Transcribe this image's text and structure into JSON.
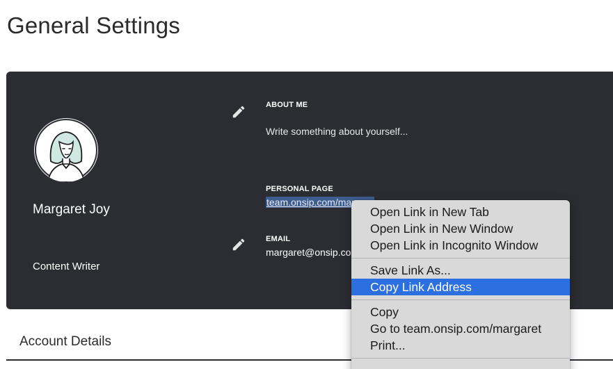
{
  "page": {
    "title": "General Settings"
  },
  "profile": {
    "name": "Margaret Joy",
    "role": "Content Writer",
    "about": {
      "label": "ABOUT ME",
      "placeholder": "Write something about yourself..."
    },
    "personal_page": {
      "label": "PERSONAL PAGE",
      "value": "team.onsip.com/margaret"
    },
    "email": {
      "label": "EMAIL",
      "value": "margaret@onsip.com"
    }
  },
  "account_details": {
    "title": "Account Details"
  },
  "context_menu": {
    "items": [
      {
        "label": "Open Link in New Tab"
      },
      {
        "label": "Open Link in New Window"
      },
      {
        "label": "Open Link in Incognito Window"
      },
      {
        "label": "Save Link As..."
      },
      {
        "label": "Copy Link Address"
      },
      {
        "label": "Copy"
      },
      {
        "label": "Go to team.onsip.com/margaret"
      },
      {
        "label": "Print..."
      }
    ],
    "highlighted": "Copy Link Address"
  },
  "colors": {
    "card_background": "#2b2d33",
    "menu_highlight": "#2c6fe0",
    "link_selection": "#3e5d8f"
  },
  "icons": [
    "avatar-illustration",
    "pencil-icon"
  ]
}
